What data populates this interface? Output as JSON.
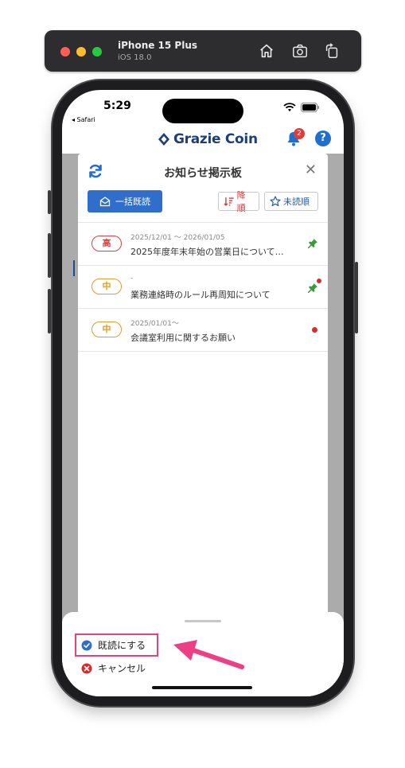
{
  "simulator": {
    "device_name": "iPhone 15 Plus",
    "os_version": "iOS 18.0",
    "icons": [
      "home-icon",
      "screenshot-icon",
      "rotate-icon"
    ]
  },
  "status_bar": {
    "time": "5:29",
    "back_label": "◂ Safari"
  },
  "app_header": {
    "logo_text": "Grazie Coin",
    "notification_count": "2",
    "help_label": "?"
  },
  "modal": {
    "title": "お知らせ掲示板",
    "close_label": "✕",
    "mark_all_read_label": "一括既読",
    "sort_desc_label": "降順",
    "sort_unread_label": "未読順",
    "items": [
      {
        "priority": "高",
        "priority_level": "high",
        "date": "2025/12/01 ～ 2026/01/05",
        "title": "2025年度年末年始の営業日について…",
        "pinned": true,
        "unread": false
      },
      {
        "priority": "中",
        "priority_level": "mid",
        "date": "-",
        "title": "業務連絡時のルール再周知について",
        "pinned": true,
        "unread": true
      },
      {
        "priority": "中",
        "priority_level": "mid",
        "date": "2025/01/01～",
        "title": "会議室利用に関するお願い",
        "pinned": false,
        "unread": true
      }
    ]
  },
  "action_sheet": {
    "mark_read_label": "既読にする",
    "cancel_label": "キャンセル"
  },
  "colors": {
    "primary": "#2f6fcb",
    "high_priority": "#d94040",
    "mid_priority": "#e59a2a",
    "pin": "#3c9a3c",
    "highlight": "#e8407a"
  }
}
